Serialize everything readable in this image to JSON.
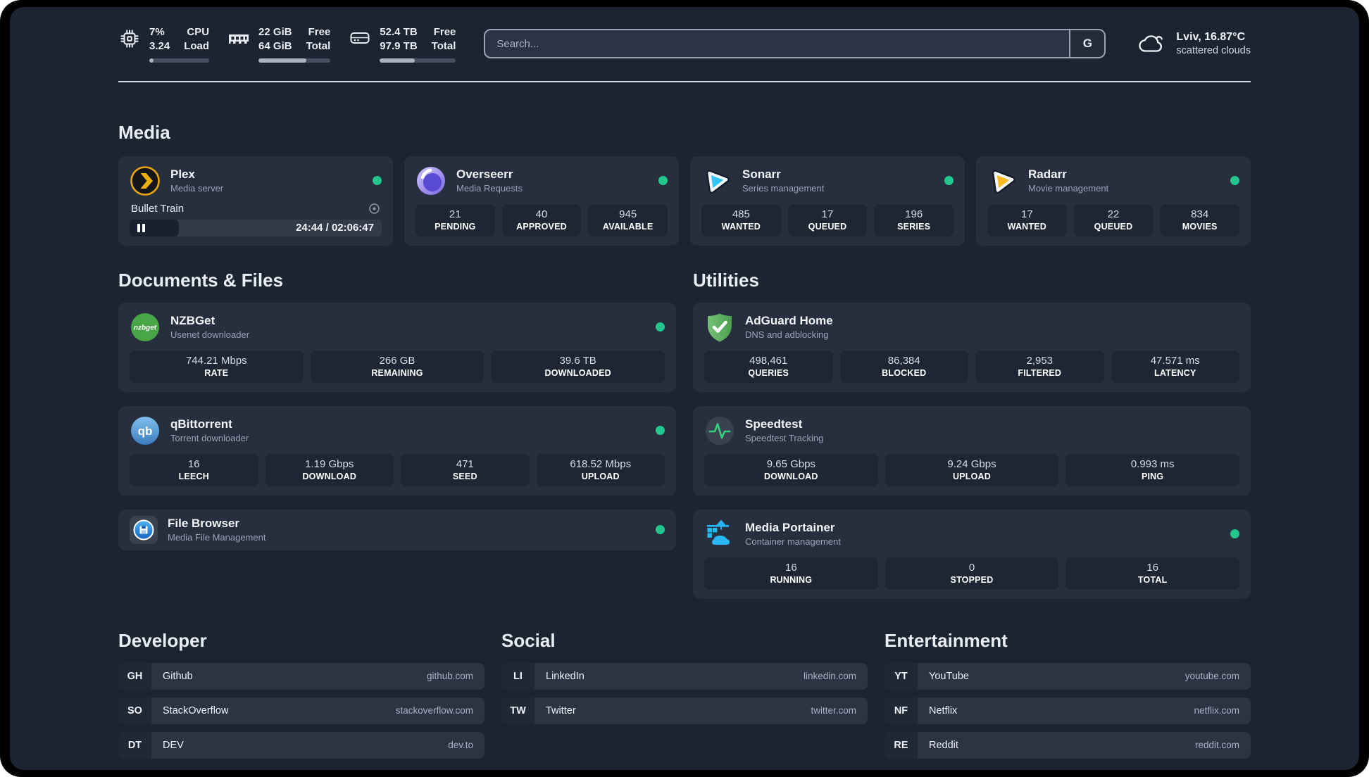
{
  "header": {
    "metrics": [
      {
        "icon": "cpu",
        "top_value": "7%",
        "bottom_value": "3.24",
        "top_label": "CPU",
        "bottom_label": "Load",
        "progress_pct": 7
      },
      {
        "icon": "memory",
        "top_value": "22 GiB",
        "bottom_value": "64 GiB",
        "top_label": "Free",
        "bottom_label": "Total",
        "progress_pct": 66
      },
      {
        "icon": "storage",
        "top_value": "52.4 TB",
        "bottom_value": "97.9 TB",
        "top_label": "Free",
        "bottom_label": "Total",
        "progress_pct": 46
      }
    ],
    "search": {
      "placeholder": "Search...",
      "engine_label": "G"
    },
    "weather": {
      "location": "Lviv, 16.87°C",
      "condition": "scattered clouds"
    }
  },
  "sections": {
    "media": {
      "title": "Media",
      "cards": [
        {
          "name": "Plex",
          "description": "Media server",
          "online": true,
          "now_playing": {
            "title": "Bullet Train",
            "time_display": "24:44 / 02:06:47",
            "progress_pct": 19.5
          }
        },
        {
          "name": "Overseerr",
          "description": "Media Requests",
          "online": true,
          "stats": [
            {
              "value": "21",
              "label": "PENDING"
            },
            {
              "value": "40",
              "label": "APPROVED"
            },
            {
              "value": "945",
              "label": "AVAILABLE"
            }
          ]
        },
        {
          "name": "Sonarr",
          "description": "Series management",
          "online": true,
          "stats": [
            {
              "value": "485",
              "label": "WANTED"
            },
            {
              "value": "17",
              "label": "QUEUED"
            },
            {
              "value": "196",
              "label": "SERIES"
            }
          ]
        },
        {
          "name": "Radarr",
          "description": "Movie management",
          "online": true,
          "stats": [
            {
              "value": "17",
              "label": "WANTED"
            },
            {
              "value": "22",
              "label": "QUEUED"
            },
            {
              "value": "834",
              "label": "MOVIES"
            }
          ]
        }
      ]
    },
    "documents": {
      "title": "Documents & Files",
      "cards": [
        {
          "name": "NZBGet",
          "description": "Usenet downloader",
          "online": true,
          "stats": [
            {
              "value": "744.21 Mbps",
              "label": "RATE"
            },
            {
              "value": "266 GB",
              "label": "REMAINING"
            },
            {
              "value": "39.6 TB",
              "label": "DOWNLOADED"
            }
          ]
        },
        {
          "name": "qBittorrent",
          "description": "Torrent downloader",
          "online": true,
          "stats": [
            {
              "value": "16",
              "label": "LEECH"
            },
            {
              "value": "1.19 Gbps",
              "label": "DOWNLOAD"
            },
            {
              "value": "471",
              "label": "SEED"
            },
            {
              "value": "618.52 Mbps",
              "label": "UPLOAD"
            }
          ]
        },
        {
          "name": "File Browser",
          "description": "Media File Management",
          "online": true
        }
      ]
    },
    "utilities": {
      "title": "Utilities",
      "cards": [
        {
          "name": "AdGuard Home",
          "description": "DNS and adblocking",
          "stats": [
            {
              "value": "498,461",
              "label": "QUERIES"
            },
            {
              "value": "86,384",
              "label": "BLOCKED"
            },
            {
              "value": "2,953",
              "label": "FILTERED"
            },
            {
              "value": "47.571 ms",
              "label": "LATENCY"
            }
          ]
        },
        {
          "name": "Speedtest",
          "description": "Speedtest Tracking",
          "stats": [
            {
              "value": "9.65 Gbps",
              "label": "DOWNLOAD"
            },
            {
              "value": "9.24 Gbps",
              "label": "UPLOAD"
            },
            {
              "value": "0.993 ms",
              "label": "PING"
            }
          ]
        },
        {
          "name": "Media Portainer",
          "description": "Container management",
          "online": true,
          "stats": [
            {
              "value": "16",
              "label": "RUNNING"
            },
            {
              "value": "0",
              "label": "STOPPED"
            },
            {
              "value": "16",
              "label": "TOTAL"
            }
          ]
        }
      ]
    },
    "developer": {
      "title": "Developer",
      "links": [
        {
          "abbr": "GH",
          "name": "Github",
          "url": "github.com"
        },
        {
          "abbr": "SO",
          "name": "StackOverflow",
          "url": "stackoverflow.com"
        },
        {
          "abbr": "DT",
          "name": "DEV",
          "url": "dev.to"
        }
      ]
    },
    "social": {
      "title": "Social",
      "links": [
        {
          "abbr": "LI",
          "name": "LinkedIn",
          "url": "linkedin.com"
        },
        {
          "abbr": "TW",
          "name": "Twitter",
          "url": "twitter.com"
        }
      ]
    },
    "entertainment": {
      "title": "Entertainment",
      "links": [
        {
          "abbr": "YT",
          "name": "YouTube",
          "url": "youtube.com"
        },
        {
          "abbr": "NF",
          "name": "Netflix",
          "url": "netflix.com"
        },
        {
          "abbr": "RE",
          "name": "Reddit",
          "url": "reddit.com"
        }
      ]
    }
  },
  "colors": {
    "accent_green": "#23c68d",
    "page_bg": "#1c2431",
    "card_bg": "#272e3d",
    "tile_bg": "#1f2633"
  }
}
